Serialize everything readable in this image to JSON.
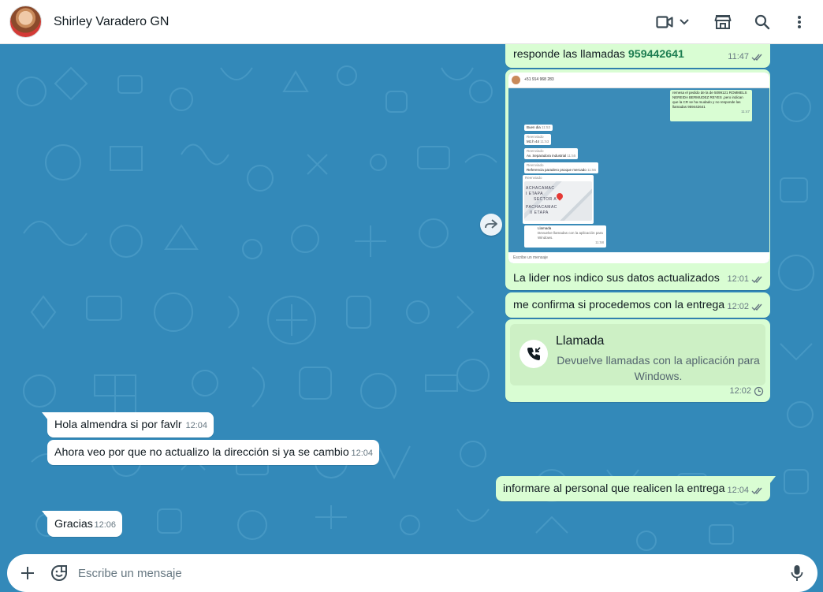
{
  "header": {
    "contact_name": "Shirley Varadero GN",
    "icons": [
      "video-call-icon",
      "chevron-down-icon",
      "catalog-store-icon",
      "search-icon",
      "more-options-icon"
    ]
  },
  "messages": [
    {
      "dir": "out",
      "type": "text",
      "text_prefix": "responde las llamadas",
      "phone": "959442641",
      "time": "11:47",
      "status": "read"
    },
    {
      "dir": "out",
      "type": "image",
      "caption": "La lider nos indico sus datos actualizados",
      "time": "12:01",
      "status": "read",
      "image_texts": {
        "top_number": "+51 914 968 283",
        "quoted": "remesa el pedido de la de 5099121 ROMMELS NEREIDA BERMUDEZ REYES ,pero indican que la CR se ha mudado y no responde las llamadas 959442641",
        "quoted_time": "11:47",
        "b1": "Buen dia",
        "b1_time": "11:53",
        "b2_fwd": "Reenviado",
        "b2": "Mz.h 44",
        "b2_time": "11:53",
        "b3_fwd": "Reenviado",
        "b3": "Av. Separadora industrial",
        "b3_time": "11:55",
        "b4_fwd": "Reenviado",
        "b4": "Referencia paradero psoque mercado",
        "b4_time": "11:56",
        "b5_fwd": "Reenviado",
        "map_labels": [
          "ACHACAMAC",
          "I ETAPA",
          "SECTOR A",
          "PACHACAMAC",
          "II ETAPA"
        ],
        "call_title": "Llamada",
        "call_sub": "Devuelve llamadas con la aplicación para Windows.",
        "call_time": "11:58",
        "composer": "Escribe un mensaje"
      }
    },
    {
      "dir": "out",
      "type": "text",
      "text": "me confirma si procedemos con la entrega",
      "time": "12:02",
      "status": "read"
    },
    {
      "dir": "out",
      "type": "call",
      "title": "Llamada",
      "subtitle": "Devuelve llamadas con la aplicación para Windows.",
      "time": "12:02",
      "status": "pending"
    },
    {
      "dir": "in",
      "type": "text",
      "text": "Hola almendra si por favlr",
      "time": "12:04"
    },
    {
      "dir": "in",
      "type": "text",
      "text": "Ahora veo por que no actualizo la dirección si ya se cambio",
      "time": "12:04"
    },
    {
      "dir": "out",
      "type": "text",
      "text": "informare al personal que realicen la entrega",
      "time": "12:04",
      "status": "read"
    },
    {
      "dir": "in",
      "type": "text",
      "text": "Gracias",
      "time": "12:06"
    }
  ],
  "composer": {
    "placeholder": "Escribe un mensaje",
    "icons": [
      "plus-icon",
      "sticker-icon",
      "microphone-icon"
    ]
  },
  "colors": {
    "chat_background": "#3389b9",
    "outgoing_bubble": "#d9fdd3",
    "incoming_bubble": "#ffffff",
    "read_ticks": "#667781",
    "phone_link": "#1d7d51"
  }
}
